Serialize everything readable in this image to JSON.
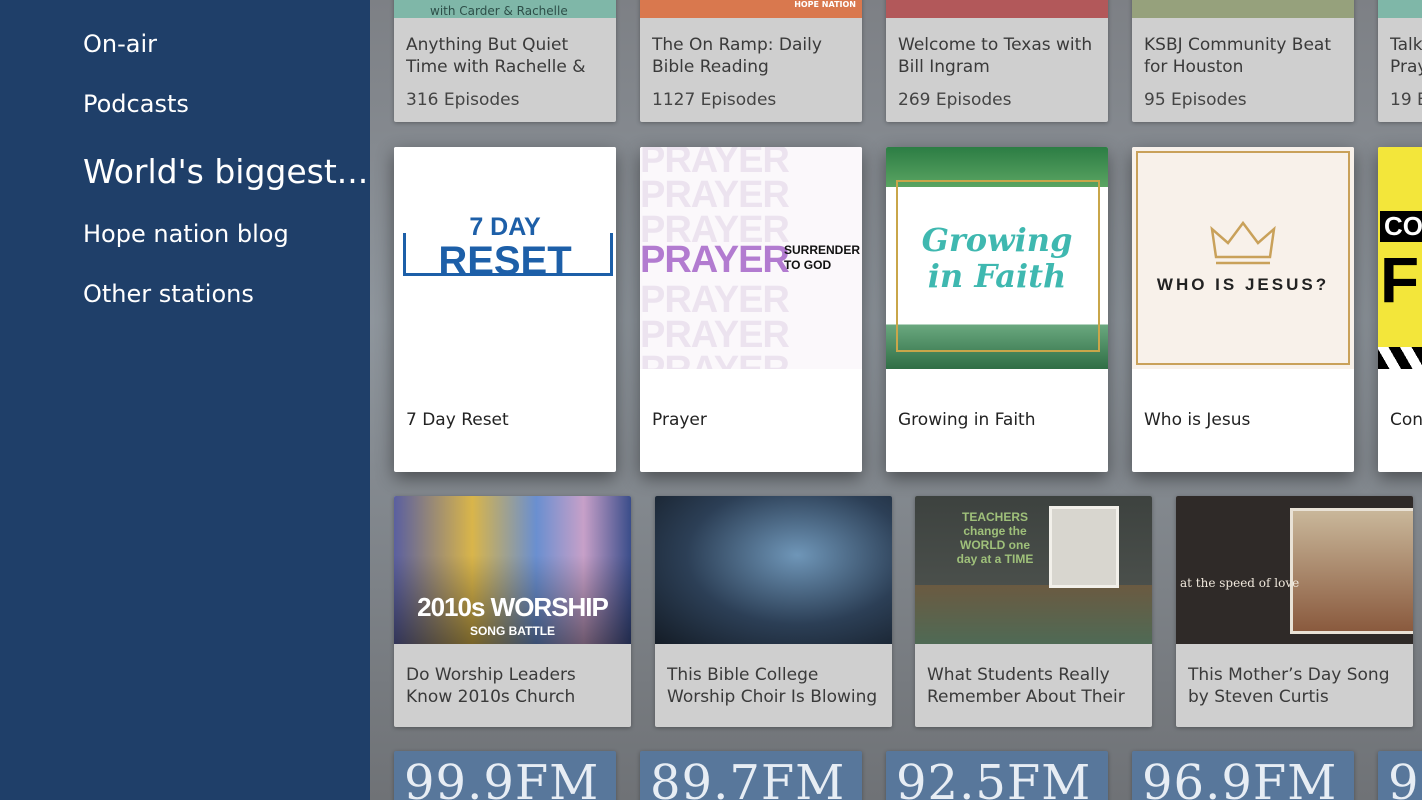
{
  "sidebar": {
    "items": [
      {
        "label": "On-air"
      },
      {
        "label": "Podcasts"
      },
      {
        "label": "World's biggest..."
      },
      {
        "label": "Hope nation blog"
      },
      {
        "label": "Other stations"
      }
    ],
    "active_index": 2
  },
  "row1": [
    {
      "title": "Anything But Quiet Time with Rachelle &",
      "episodes": "316 Episodes",
      "thumb_text": "with Carder & Rachelle"
    },
    {
      "title": "The On Ramp: Daily Bible Reading",
      "episodes": "1127 Episodes",
      "thumb_text": "HOPE NATION"
    },
    {
      "title": "Welcome to Texas with Bill Ingram",
      "episodes": "269 Episodes"
    },
    {
      "title": "KSBJ Community Beat for Houston",
      "episodes": "95 Episodes"
    },
    {
      "title": "Talk Pray",
      "episodes": "19 E"
    }
  ],
  "row2": [
    {
      "title": "7 Day Reset",
      "art_top": "7 DAY",
      "art_main": "RESET"
    },
    {
      "title": "Prayer",
      "art_word": "PRAYER",
      "art_side": "SURRENDER TO GOD"
    },
    {
      "title": "Growing in Faith",
      "art_line1": "Growing",
      "art_line2": "in Faith"
    },
    {
      "title": "Who is Jesus",
      "art_text": "WHO IS JESUS?"
    },
    {
      "title": "Con",
      "art_text": "CO F"
    }
  ],
  "row3": [
    {
      "title": "Do Worship Leaders Know 2010s Church",
      "art_main": "2010s WORSHIP",
      "art_sub": "SONG BATTLE"
    },
    {
      "title": "This Bible College Worship Choir Is Blowing"
    },
    {
      "title": "What Students Really Remember About Their",
      "art_text": "TEACHERS change the WORLD one day at a TIME"
    },
    {
      "title": "This Mother’s Day Song by Steven Curtis",
      "art_text": "at the speed of love"
    }
  ],
  "row4": [
    {
      "label": "99.9FM"
    },
    {
      "label": "89.7FM"
    },
    {
      "label": "92.5FM"
    },
    {
      "label": "96.9FM"
    },
    {
      "label": "9"
    }
  ],
  "colors": {
    "sidebar": "#1f3f69",
    "station_tile": "#58779b",
    "reset_blue": "#1d5fa8",
    "prayer_purple": "#b27bd0",
    "faith_teal": "#3fb8b0"
  }
}
